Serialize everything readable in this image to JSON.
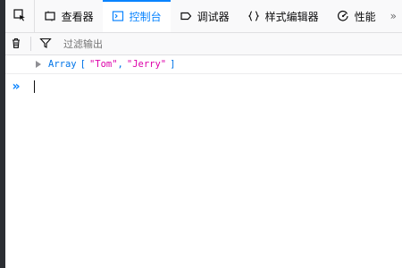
{
  "toolbar": {
    "tabs": [
      {
        "label": "查看器",
        "icon": "inspector-icon",
        "selected": false
      },
      {
        "label": "控制台",
        "icon": "console-icon",
        "selected": true
      },
      {
        "label": "调试器",
        "icon": "debugger-icon",
        "selected": false
      },
      {
        "label": "样式编辑器",
        "icon": "braces-icon",
        "selected": false
      },
      {
        "label": "性能",
        "icon": "performance-icon",
        "selected": false
      }
    ],
    "overflow": "»"
  },
  "filterbar": {
    "placeholder": "过滤输出"
  },
  "console": {
    "output": {
      "type": "Array",
      "open_bracket": "[",
      "items": [
        "\"Tom\"",
        "\"Jerry\""
      ],
      "separator": ",",
      "close_bracket": "]"
    },
    "prompt": "»"
  },
  "colors": {
    "accent": "#0a84ff",
    "keyword": "#0074e8",
    "string": "#dd00a9",
    "toolbar_bg": "#f9f9fa"
  }
}
